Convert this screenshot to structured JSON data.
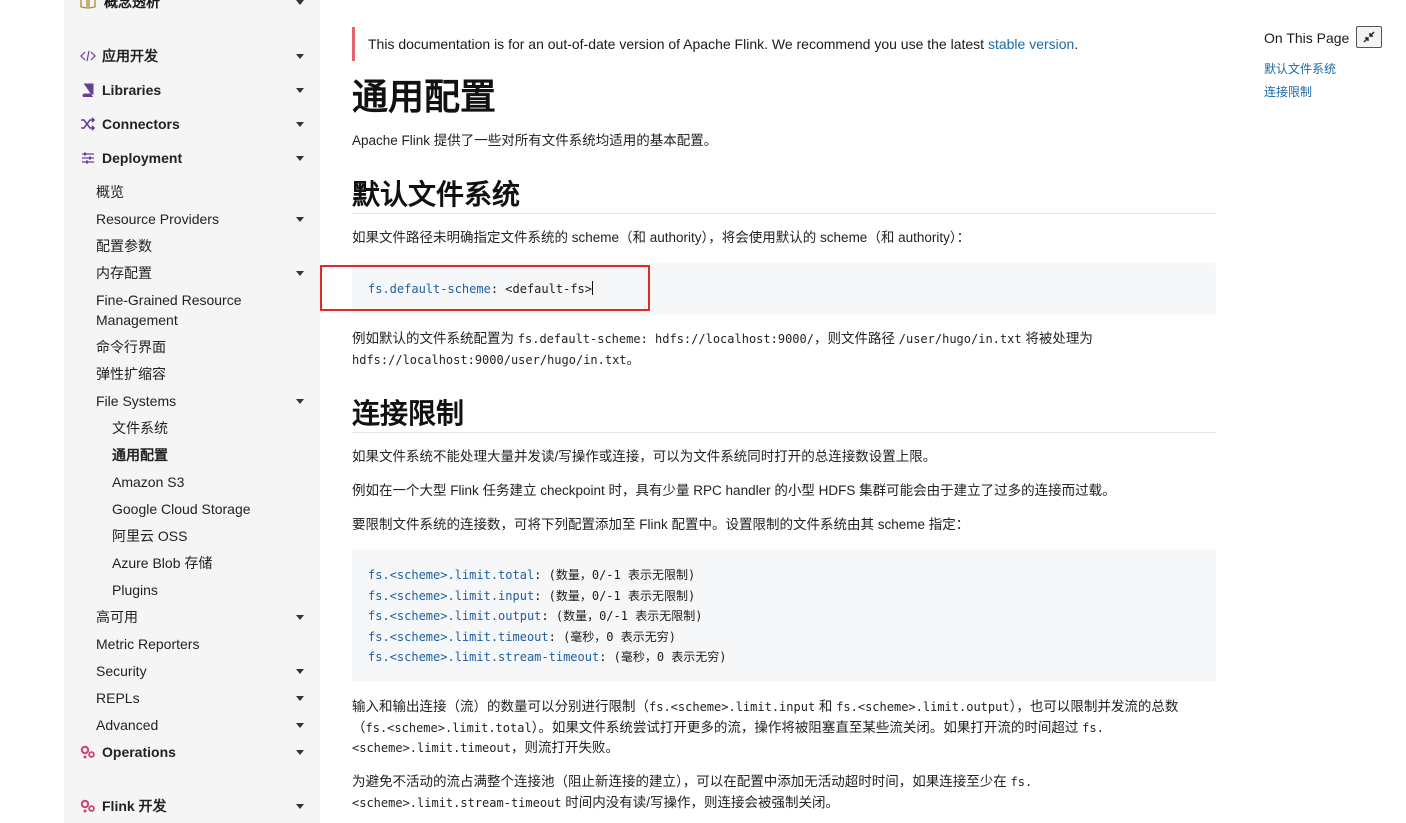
{
  "sidebar": {
    "top_partial": "概念透析",
    "sections": [
      {
        "label": "应用开发",
        "icon": "code-icon"
      },
      {
        "label": "Libraries",
        "icon": "book-icon"
      },
      {
        "label": "Connectors",
        "icon": "shuffle-icon"
      },
      {
        "label": "Deployment",
        "icon": "sliders-icon"
      }
    ],
    "deployment_items": [
      {
        "label": "概览"
      },
      {
        "label": "Resource Providers"
      },
      {
        "label": "配置参数"
      },
      {
        "label": "内存配置"
      },
      {
        "label": "Fine-Grained Resource Management"
      },
      {
        "label": "命令行界面"
      },
      {
        "label": "弹性扩缩容"
      },
      {
        "label": "File Systems"
      }
    ],
    "fs_items": [
      {
        "label": "文件系统"
      },
      {
        "label": "通用配置"
      },
      {
        "label": "Amazon S3"
      },
      {
        "label": "Google Cloud Storage"
      },
      {
        "label": "阿里云 OSS"
      },
      {
        "label": "Azure Blob 存储"
      },
      {
        "label": "Plugins"
      }
    ],
    "deployment_items_after": [
      {
        "label": "高可用"
      },
      {
        "label": "Metric Reporters"
      },
      {
        "label": "Security"
      },
      {
        "label": "REPLs"
      },
      {
        "label": "Advanced"
      }
    ],
    "sections_after": [
      {
        "label": "Operations",
        "icon": "gears-icon"
      },
      {
        "label": "Flink 开发",
        "icon": "gears-icon"
      }
    ]
  },
  "alert": {
    "text": "This documentation is for an out-of-date version of Apache Flink. We recommend you use the latest ",
    "link": "stable version",
    "end": "."
  },
  "content": {
    "title": "通用配置",
    "intro": "Apache Flink 提供了一些对所有文件系统均适用的基本配置。",
    "h_default": "默认文件系统",
    "p_default": "如果文件路径未明确指定文件系统的 scheme（和 authority），将会使用默认的 scheme（和 authority）：",
    "code1_key": "fs.default-scheme",
    "code1_val": ": <default-fs>",
    "p_example_1": "例如默认的文件系统配置为 ",
    "p_example_code1": "fs.default-scheme: hdfs://localhost:9000/",
    "p_example_2": "，则文件路径 ",
    "p_example_code2": "/user/hugo/in.txt",
    "p_example_3": " 将被处理为",
    "p_example_code3": "hdfs://localhost:9000/user/hugo/in.txt",
    "p_example_4": "。",
    "h_limit": "连接限制",
    "p_limit1": "如果文件系统不能处理大量并发读/写操作或连接，可以为文件系统同时打开的总连接数设置上限。",
    "p_limit2": "例如在一个大型 Flink 任务建立 checkpoint 时，具有少量 RPC handler 的小型 HDFS 集群可能会由于建立了过多的连接而过载。",
    "p_limit3": "要限制文件系统的连接数，可将下列配置添加至 Flink 配置中。设置限制的文件系统由其 scheme 指定：",
    "code2": [
      {
        "key": "fs.<scheme>.limit.total",
        "val": ": (数量，0/-1 表示无限制)"
      },
      {
        "key": "fs.<scheme>.limit.input",
        "val": ": (数量，0/-1 表示无限制)"
      },
      {
        "key": "fs.<scheme>.limit.output",
        "val": ": (数量，0/-1 表示无限制)"
      },
      {
        "key": "fs.<scheme>.limit.timeout",
        "val": ": (毫秒，0 表示无穷)"
      },
      {
        "key": "fs.<scheme>.limit.stream-timeout",
        "val": ": (毫秒，0 表示无穷)"
      }
    ],
    "p_io_a": "输入和输出连接（流）的数量可以分别进行限制（",
    "p_io_c1": "fs.<scheme>.limit.input",
    "p_io_b": " 和 ",
    "p_io_c2": "fs.<scheme>.limit.output",
    "p_io_c": "），也可以限制并发流的总数",
    "p_io_d": "（",
    "p_io_c3": "fs.<scheme>.limit.total",
    "p_io_e": "）。如果文件系统尝试打开更多的流，操作将被阻塞直至某些流关闭。如果打开流的时间超过 ",
    "p_io_c4a": "fs.",
    "p_io_c4b": "<scheme>.limit.timeout",
    "p_io_f": "，则流打开失败。",
    "p_idle_a": "为避免不活动的流占满整个连接池（阻止新连接的建立），可以在配置中添加无活动超时时间，如果连接至少在 ",
    "p_idle_c1a": "fs.",
    "p_idle_c1b": "<scheme>.limit.stream-timeout",
    "p_idle_b": " 时间内没有读/写操作，则连接会被强制关闭。"
  },
  "toc": {
    "title": "On This Page",
    "collapse_icon": "collapse-icon",
    "links": [
      "默认文件系统",
      "连接限制"
    ]
  }
}
